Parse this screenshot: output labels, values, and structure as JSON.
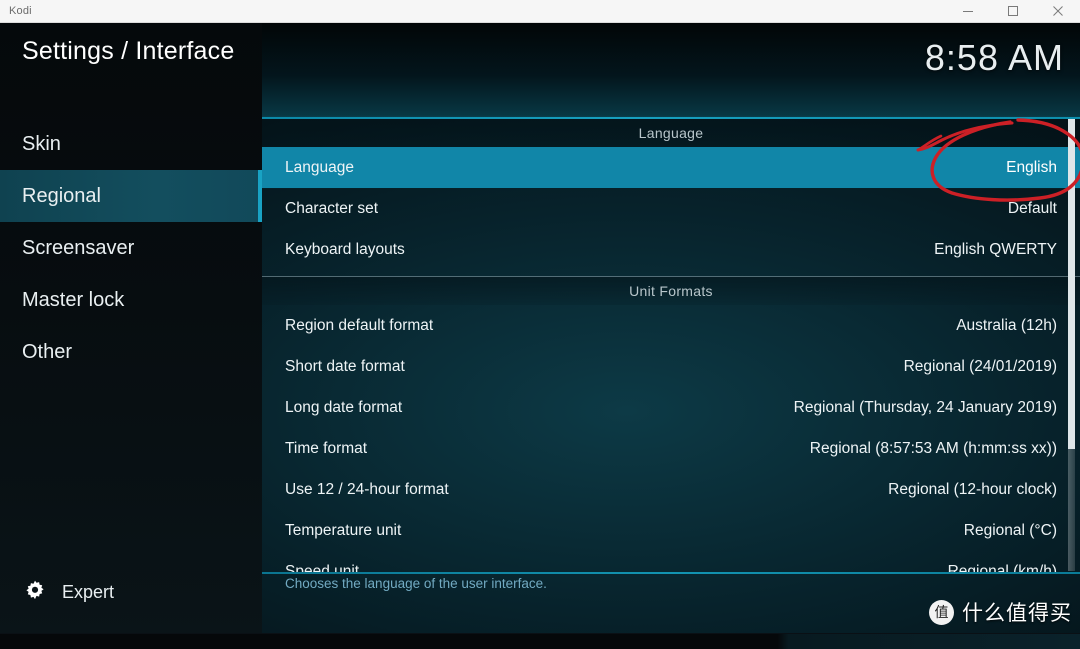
{
  "window": {
    "title": "Kodi",
    "controls": [
      {
        "name": "minimize",
        "glyph": "minimize-icon"
      },
      {
        "name": "maximize",
        "glyph": "maximize-icon"
      },
      {
        "name": "close",
        "glyph": "close-icon"
      }
    ]
  },
  "header": {
    "title": "Settings / Interface",
    "clock": "8:58 AM"
  },
  "sidebar": {
    "items": [
      {
        "label": "Skin",
        "selected": false
      },
      {
        "label": "Regional",
        "selected": true
      },
      {
        "label": "Screensaver",
        "selected": false
      },
      {
        "label": "Master lock",
        "selected": false
      },
      {
        "label": "Other",
        "selected": false
      }
    ],
    "level": {
      "icon": "gear-icon",
      "label": "Expert"
    }
  },
  "main": {
    "groups": [
      {
        "header": "Language",
        "rows": [
          {
            "label": "Language",
            "value": "English",
            "selected": true
          },
          {
            "label": "Character set",
            "value": "Default",
            "selected": false
          },
          {
            "label": "Keyboard layouts",
            "value": "English QWERTY",
            "selected": false
          }
        ]
      },
      {
        "header": "Unit Formats",
        "rows": [
          {
            "label": "Region default format",
            "value": "Australia (12h)",
            "selected": false
          },
          {
            "label": "Short date format",
            "value": "Regional (24/01/2019)",
            "selected": false
          },
          {
            "label": "Long date format",
            "value": "Regional (Thursday, 24 January 2019)",
            "selected": false
          },
          {
            "label": "Time format",
            "value": "Regional (8:57:53 AM (h:mm:ss xx))",
            "selected": false
          },
          {
            "label": "Use 12 / 24-hour format",
            "value": "Regional (12-hour clock)",
            "selected": false
          },
          {
            "label": "Temperature unit",
            "value": "Regional (°C)",
            "selected": false
          },
          {
            "label": "Speed unit",
            "value": "Regional (km/h)",
            "selected": false
          }
        ]
      }
    ],
    "help": "Chooses the language of the user interface."
  },
  "annotation": {
    "type": "hand-drawn-ellipse",
    "color": "#cc2026",
    "target": "English"
  },
  "watermark": {
    "badge": "值",
    "text": "什么值得买"
  },
  "colors": {
    "row_highlight": "#1186a8",
    "sidebar_highlight": "#134e5e",
    "accent_line": "#14a0c0",
    "help_text": "#72aac2",
    "annotation_red": "#cc2026"
  }
}
